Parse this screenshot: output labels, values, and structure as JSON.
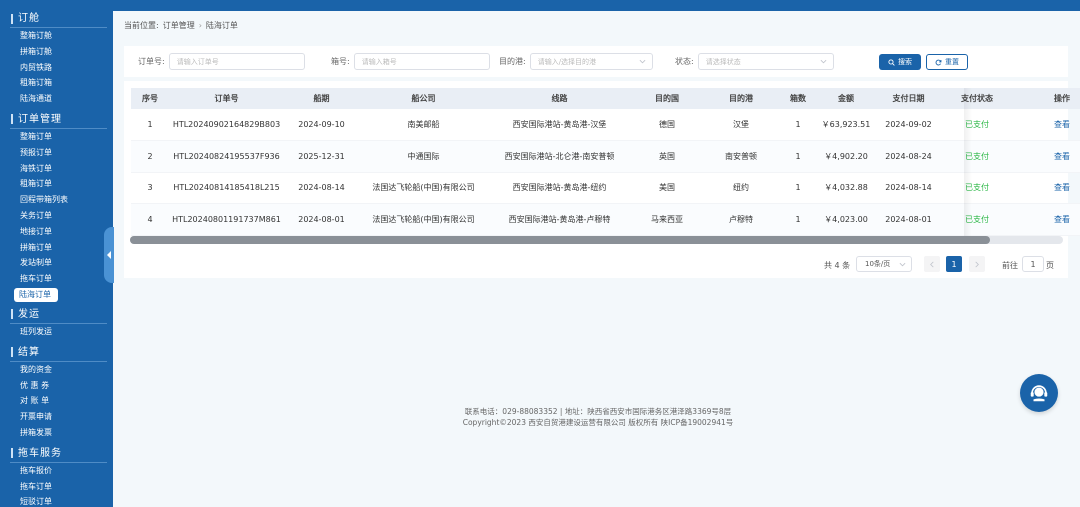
{
  "sidebar": {
    "sections": [
      {
        "title": "订舱",
        "items": [
          "整箱订舱",
          "拼箱订舱",
          "内贸铁路",
          "租箱订箱",
          "陆海通道"
        ]
      },
      {
        "title": "订单管理",
        "items": [
          "整箱订单",
          "预报订单",
          "海铁订单",
          "租箱订单",
          "回程带箱列表",
          "关务订单",
          "地接订单",
          "拼箱订单",
          "发站制单",
          "拖车订单",
          "陆海订单"
        ]
      },
      {
        "title": "发运",
        "items": [
          "班列发运"
        ]
      },
      {
        "title": "结算",
        "items": [
          "我的资金",
          "优 惠 券",
          "对 账 单",
          "开票申请",
          "拼箱发票"
        ]
      },
      {
        "title": "拖车服务",
        "items": [
          "拖车报价",
          "拖车订单",
          "短驳订单"
        ]
      }
    ],
    "active_item": "陆海订单"
  },
  "breadcrumb": {
    "prefix": "当前位置:",
    "level1": "订单管理",
    "sep": "›",
    "level2": "陆海订单"
  },
  "search": {
    "order_label": "订单号:",
    "order_placeholder": "请输入订单号",
    "box_label": "箱号:",
    "box_placeholder": "请输入箱号",
    "dest_label": "目的港:",
    "dest_placeholder": "请输入/选择目的港",
    "status_label": "状态:",
    "status_placeholder": "请选择状态",
    "search_btn": "搜索",
    "reset_btn": "重置"
  },
  "table": {
    "headers": [
      "序号",
      "订单号",
      "船期",
      "船公司",
      "线路",
      "目的国",
      "目的港",
      "箱数",
      "金额",
      "支付日期",
      "支付状态",
      "操作"
    ],
    "rows": [
      [
        "1",
        "HTL20240902164829B803",
        "2024-09-10",
        "南美邮船",
        "西安国际港站-黄岛港-汉堡",
        "德国",
        "汉堡",
        "1",
        "￥63,923.51",
        "2024-09-02",
        "已支付",
        "查看"
      ],
      [
        "2",
        "HTL20240824195537F936",
        "2025-12-31",
        "中通国际",
        "西安国际港站-北仑港-南安普顿",
        "英国",
        "南安普顿",
        "1",
        "￥4,902.20",
        "2024-08-24",
        "已支付",
        "查看"
      ],
      [
        "3",
        "HTL20240814185418L215",
        "2024-08-14",
        "法国达飞轮船(中国)有限公司",
        "西安国际港站-黄岛港-纽约",
        "美国",
        "纽约",
        "1",
        "￥4,032.88",
        "2024-08-14",
        "已支付",
        "查看"
      ],
      [
        "4",
        "HTL20240801191737M861",
        "2024-08-01",
        "法国达飞轮船(中国)有限公司",
        "西安国际港站-黄岛港-卢穆特",
        "马来西亚",
        "卢穆特",
        "1",
        "￥4,023.00",
        "2024-08-01",
        "已支付",
        "查看"
      ]
    ]
  },
  "pager": {
    "total": "共 4 条",
    "size": "10条/页",
    "current": "1",
    "goto": "前往",
    "jump_value": "1",
    "unit": "页"
  },
  "footer": {
    "line1": "联系电话：029-88083352 | 地址：陕西省西安市国际港务区港泽路3369号8层",
    "line2": "Copyright©2023 西安自贸港建设运营有限公司 版权所有 陕ICP备19002941号"
  },
  "colors": {
    "primary": "#1a63a9",
    "paid": "#2db848"
  }
}
